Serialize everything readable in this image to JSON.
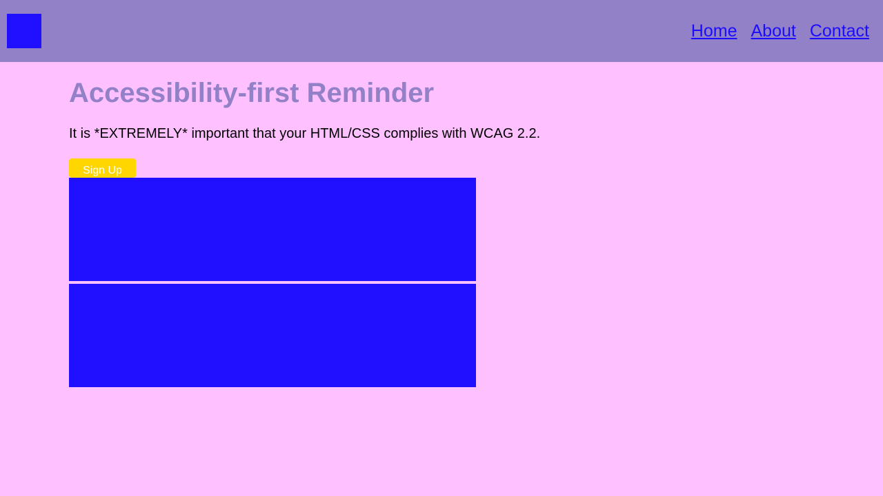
{
  "header": {
    "logo_icon": "square-logo-icon",
    "nav": [
      {
        "label": "Home"
      },
      {
        "label": "About"
      },
      {
        "label": "Contact"
      }
    ]
  },
  "main": {
    "title": "Accessibility-first Reminder",
    "paragraph": "It is *EXTREMELY* important that your HTML/CSS complies with WCAG 2.2.",
    "signup_label": "Sign Up"
  },
  "colors": {
    "background": "#ffc0ff",
    "header": "#9381c8",
    "logo": "#2010ff",
    "link": "#1a0dff",
    "button": "#ffd600",
    "button_text": "#ffffff",
    "blocks": "#2010ff"
  }
}
